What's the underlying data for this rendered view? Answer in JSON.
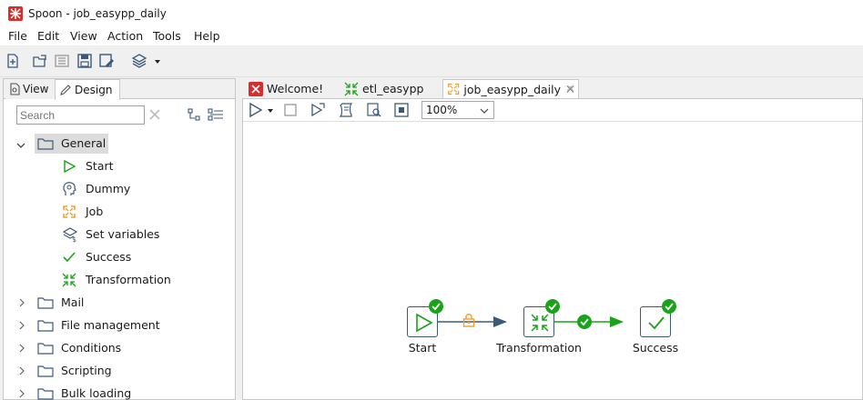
{
  "window": {
    "title": "Spoon - job_easypp_daily"
  },
  "menu": {
    "file": "File",
    "edit": "Edit",
    "view": "View",
    "action": "Action",
    "tools": "Tools",
    "help": "Help"
  },
  "left_panel": {
    "tab_view": "View",
    "tab_design": "Design",
    "search_placeholder": "Search",
    "tree": {
      "general": {
        "label": "General",
        "expanded": true,
        "children": [
          "Start",
          "Dummy",
          "Job",
          "Set variables",
          "Success",
          "Transformation"
        ]
      },
      "categories": [
        "Mail",
        "File management",
        "Conditions",
        "Scripting",
        "Bulk loading"
      ]
    }
  },
  "editor_tabs": [
    {
      "label": "Welcome!",
      "icon": "welcome-icon"
    },
    {
      "label": "etl_easypp",
      "icon": "transformation-icon"
    },
    {
      "label": "job_easypp_daily",
      "icon": "job-icon",
      "active": true
    }
  ],
  "canvas_toolbar": {
    "zoom_value": "100%"
  },
  "job_graph": {
    "nodes": [
      {
        "id": "start",
        "label": "Start",
        "icon": "start-icon",
        "status": "success"
      },
      {
        "id": "transformation",
        "label": "Transformation",
        "icon": "transformation-icon",
        "status": "success"
      },
      {
        "id": "success",
        "label": "Success",
        "icon": "success-icon",
        "status": "success"
      }
    ],
    "hops": [
      {
        "from": "start",
        "to": "transformation",
        "type": "unconditional",
        "icon": "lock-icon"
      },
      {
        "from": "transformation",
        "to": "success",
        "type": "on-success",
        "icon": "check-icon"
      }
    ]
  },
  "colors": {
    "accent_green": "#1aa21a",
    "hop_blue": "#3c5a78",
    "lock_orange": "#f0a030",
    "job_orange": "#f0a030",
    "welcome_red": "#d32f2f"
  }
}
